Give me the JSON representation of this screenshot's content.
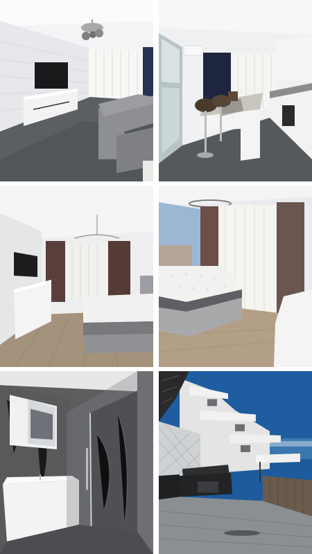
{
  "gallery": {
    "photos": [
      {
        "subject": "living-room"
      },
      {
        "subject": "kitchen"
      },
      {
        "subject": "bedroom-1"
      },
      {
        "subject": "bedroom-2"
      },
      {
        "subject": "bathroom"
      },
      {
        "subject": "terrace"
      }
    ]
  },
  "colors": {
    "wall_white": "#e9ecef",
    "terrazzo_floor": "#5b5e62",
    "wood_floor": "#a4927c",
    "curtain_brown": "#5a3e3c",
    "sheer_curtain": "#f5f4f1",
    "mattress": "#f2f1ef",
    "blue_wall": "#9cb7d4",
    "marble_grey": "#5d5d60",
    "sky_blue": "#1e5b9c",
    "sofa_grey": "#8e8f93"
  }
}
